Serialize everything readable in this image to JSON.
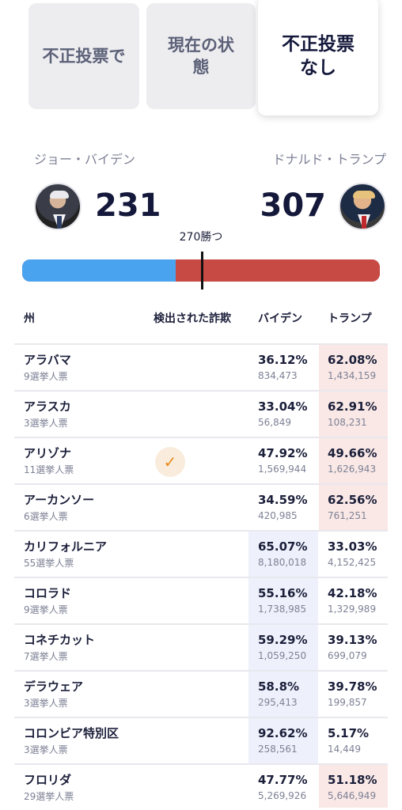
{
  "tabs": [
    {
      "label": "不正投票で"
    },
    {
      "label": "現在の状態"
    },
    {
      "label": "不正投票なし"
    }
  ],
  "candidates": {
    "biden": {
      "name": "ジョー・バイデン",
      "electoral_votes": "231"
    },
    "trump": {
      "name": "ドナルド・トランプ",
      "electoral_votes": "307"
    }
  },
  "win_label": "270勝つ",
  "bar": {
    "biden_fraction": 0.429,
    "threshold_fraction": 0.5,
    "biden_color": "#4aa3ef",
    "trump_color": "#c84a45"
  },
  "table": {
    "headers": {
      "state": "州",
      "fraud": "検出された詐欺",
      "biden": "バイデン",
      "trump": "トランプ"
    },
    "rows": [
      {
        "state": "アラバマ",
        "ev": "9選挙人票",
        "fraud": false,
        "biden_pct": "36.12%",
        "biden_votes": "834,473",
        "trump_pct": "62.08%",
        "trump_votes": "1,434,159",
        "winner": "trump"
      },
      {
        "state": "アラスカ",
        "ev": "3選挙人票",
        "fraud": false,
        "biden_pct": "33.04%",
        "biden_votes": "56,849",
        "trump_pct": "62.91%",
        "trump_votes": "108,231",
        "winner": "trump"
      },
      {
        "state": "アリゾナ",
        "ev": "11選挙人票",
        "fraud": true,
        "biden_pct": "47.92%",
        "biden_votes": "1,569,944",
        "trump_pct": "49.66%",
        "trump_votes": "1,626,943",
        "winner": "trump"
      },
      {
        "state": "アーカンソー",
        "ev": "6選挙人票",
        "fraud": false,
        "biden_pct": "34.59%",
        "biden_votes": "420,985",
        "trump_pct": "62.56%",
        "trump_votes": "761,251",
        "winner": "trump"
      },
      {
        "state": "カリフォルニア",
        "ev": "55選挙人票",
        "fraud": false,
        "biden_pct": "65.07%",
        "biden_votes": "8,180,018",
        "trump_pct": "33.03%",
        "trump_votes": "4,152,425",
        "winner": "biden"
      },
      {
        "state": "コロラド",
        "ev": "9選挙人票",
        "fraud": false,
        "biden_pct": "55.16%",
        "biden_votes": "1,738,985",
        "trump_pct": "42.18%",
        "trump_votes": "1,329,989",
        "winner": "biden"
      },
      {
        "state": "コネチカット",
        "ev": "7選挙人票",
        "fraud": false,
        "biden_pct": "59.29%",
        "biden_votes": "1,059,250",
        "trump_pct": "39.13%",
        "trump_votes": "699,079",
        "winner": "biden"
      },
      {
        "state": "デラウェア",
        "ev": "3選挙人票",
        "fraud": false,
        "biden_pct": "58.8%",
        "biden_votes": "295,413",
        "trump_pct": "39.78%",
        "trump_votes": "199,857",
        "winner": "biden"
      },
      {
        "state": "コロンビア特別区",
        "ev": "3選挙人票",
        "fraud": false,
        "biden_pct": "92.62%",
        "biden_votes": "258,561",
        "trump_pct": "5.17%",
        "trump_votes": "14,449",
        "winner": "biden"
      },
      {
        "state": "フロリダ",
        "ev": "29選挙人票",
        "fraud": false,
        "biden_pct": "47.77%",
        "biden_votes": "5,269,926",
        "trump_pct": "51.18%",
        "trump_votes": "5,646,949",
        "winner": "trump"
      }
    ],
    "fraud_icon": "checkmark-icon",
    "fraud_check_glyph": "✓"
  }
}
